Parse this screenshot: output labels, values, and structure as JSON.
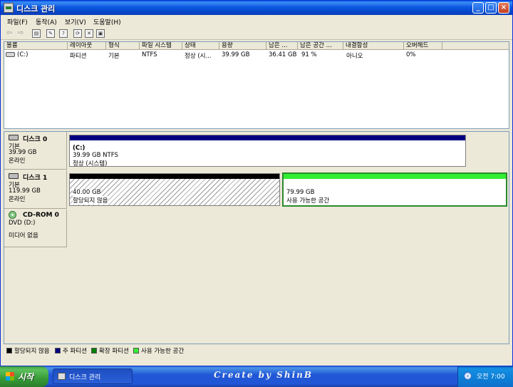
{
  "window": {
    "title": "디스크 관리",
    "buttons": {
      "minimize": "_",
      "maximize": "□",
      "close": "×"
    }
  },
  "menu": [
    "파일(F)",
    "동작(A)",
    "보기(V)",
    "도움말(H)"
  ],
  "toolbar": {
    "icons": [
      "back-arrow-icon",
      "forward-arrow-icon",
      "console-tree-icon",
      "properties-icon",
      "help-icon",
      "connect-icon",
      "delete-icon",
      "export-icon",
      "check-icon"
    ]
  },
  "volume_list": {
    "headers": [
      "볼륨",
      "레이아웃",
      "형식",
      "파일 시스템",
      "상태",
      "용량",
      "남은 ...",
      "남은 공간 ...",
      "내결함성",
      "오버헤드"
    ],
    "rows": [
      {
        "volume": "(C:)",
        "layout": "파티션",
        "type": "기본",
        "fs": "NTFS",
        "status": "정상 (시...",
        "capacity": "39.99 GB",
        "free": "36.41 GB",
        "free_pct": "91 %",
        "fault": "아니오",
        "overhead": "0%"
      }
    ]
  },
  "disks": [
    {
      "name": "디스크 0",
      "type": "기본",
      "size": "39.99 GB",
      "status": "온라인",
      "partitions": [
        {
          "label": "(C:)",
          "info": "39.99 GB NTFS",
          "status": "정상 (시스템)",
          "kind": "primary"
        }
      ]
    },
    {
      "name": "디스크 1",
      "type": "기본",
      "size": "119.99 GB",
      "status": "온라인",
      "partitions": [
        {
          "size": "40.00 GB",
          "status": "할당되지 않음",
          "kind": "unallocated"
        },
        {
          "size": "79.99 GB",
          "status": "사용 가능한 공간",
          "kind": "free"
        }
      ]
    },
    {
      "name": "CD-ROM 0",
      "type": "DVD (D:)",
      "status": "미디어 없음"
    }
  ],
  "legend": [
    {
      "label": "할당되지 않음",
      "color": "#000000"
    },
    {
      "label": "주 파티션",
      "color": "#000080"
    },
    {
      "label": "확장 파티션",
      "color": "#008000"
    },
    {
      "label": "사용 가능한 공간",
      "color": "#33ee33"
    }
  ],
  "taskbar": {
    "start_label": "시작",
    "task_label": "디스크 관리",
    "watermark": "Create by ShinB",
    "clock": "오전 7:00"
  }
}
